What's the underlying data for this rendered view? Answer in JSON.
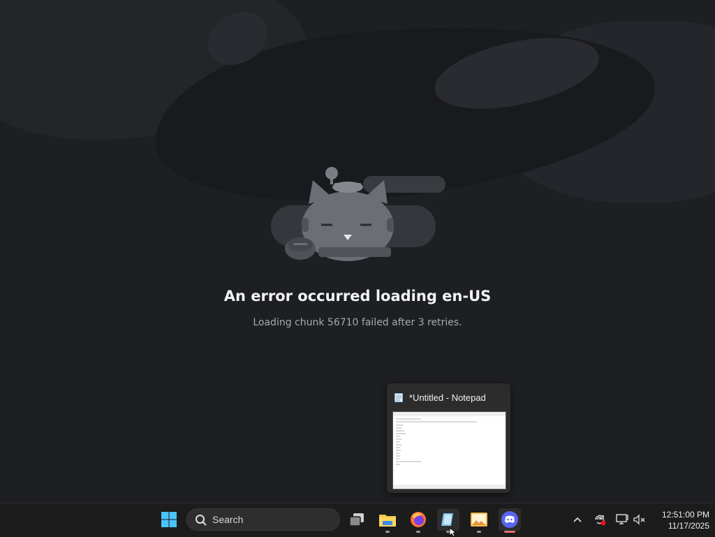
{
  "error": {
    "title": "An error occurred loading en-US",
    "message": "Loading chunk 56710 failed after 3 retries."
  },
  "taskbar_preview": {
    "title": "*Untitled - Notepad",
    "icon": "notepad-icon"
  },
  "taskbar": {
    "search_label": "Search",
    "apps": [
      "start-icon",
      "task-view-icon",
      "file-explorer-icon",
      "firefox-icon",
      "notepad-icon",
      "photos-icon",
      "discord-icon"
    ]
  },
  "system_tray": {
    "time": "12:51:00 PM",
    "date": "11/17/2025",
    "icons": [
      "chevron-up-icon",
      "sync-icon",
      "network-icon",
      "volume-muted-icon"
    ]
  },
  "colors": {
    "background": "#1e1f23",
    "taskbar": "#1c1c1c",
    "discord_accent": "#5865f2"
  }
}
